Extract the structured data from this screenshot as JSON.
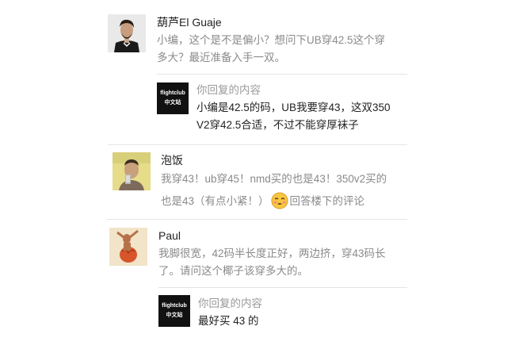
{
  "comments": [
    {
      "username": "葫芦El Guaje",
      "text_line1": "小编，这个是不是偏小？想问下UB穿42.5这个穿",
      "text_line2": "多大？最近准备入手一双。",
      "reply": {
        "logo_line1": "flightclub",
        "logo_line2": "中文站",
        "label": "你回复的内容",
        "text_line1": "小编是42.5的码，UB我要穿43，这双350",
        "text_line2": "V2穿42.5合适，不过不能穿厚袜子"
      }
    },
    {
      "username": "泡饭",
      "text_line1": "我穿43！ub穿45！nmd买的也是43！350v2买的",
      "text_line2a": "也是43（有点小紧！）",
      "emoji": "smiley-face-emoji",
      "text_line2b": "回答楼下的评论"
    },
    {
      "username": "Paul",
      "text_line1": "我脚很宽，42码半长度正好，两边挤，穿43码长",
      "text_line2": "了。请问这个椰子该穿多大的。",
      "reply": {
        "logo_line1": "flightclub",
        "logo_line2": "中文站",
        "label": "你回复的内容",
        "text_line1": "最好买 43 的"
      }
    }
  ]
}
